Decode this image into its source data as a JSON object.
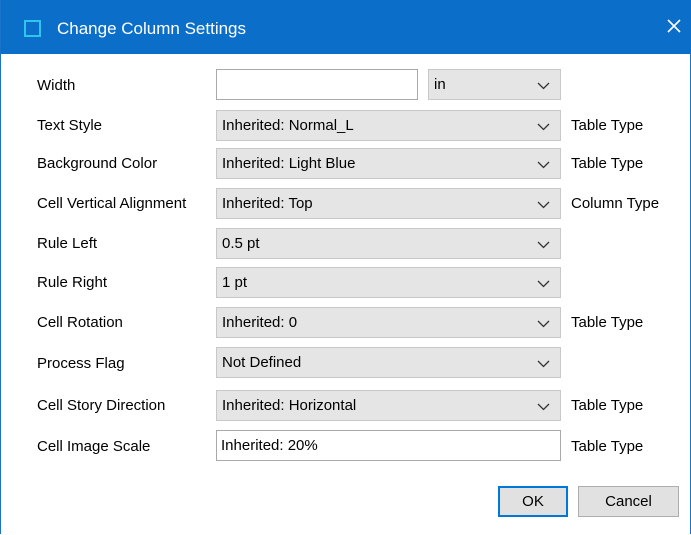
{
  "window": {
    "title": "Change Column Settings",
    "accent_color": "#0b6fc9",
    "app_icon": "window-icon",
    "close_icon": "close-icon"
  },
  "fields": {
    "width": {
      "label": "Width",
      "value": "",
      "unit": "in"
    },
    "text_style": {
      "label": "Text Style",
      "value": "Inherited: Normal_L",
      "source": "Table Type"
    },
    "background_color": {
      "label": "Background Color",
      "value": "Inherited: Light Blue",
      "source": "Table Type"
    },
    "cell_vertical_alignment": {
      "label": "Cell Vertical Alignment",
      "value": "Inherited: Top",
      "source": "Column Type"
    },
    "rule_left": {
      "label": "Rule Left",
      "value": "0.5 pt"
    },
    "rule_right": {
      "label": "Rule Right",
      "value": "1 pt"
    },
    "cell_rotation": {
      "label": "Cell Rotation",
      "value": "Inherited: 0",
      "source": "Table Type"
    },
    "process_flag": {
      "label": "Process Flag",
      "value": "Not Defined"
    },
    "cell_story_direction": {
      "label": "Cell Story Direction",
      "value": "Inherited: Horizontal",
      "source": "Table Type"
    },
    "cell_image_scale": {
      "label": "Cell Image Scale",
      "value": "Inherited: 20%",
      "source": "Table Type"
    }
  },
  "buttons": {
    "ok": "OK",
    "cancel": "Cancel"
  }
}
